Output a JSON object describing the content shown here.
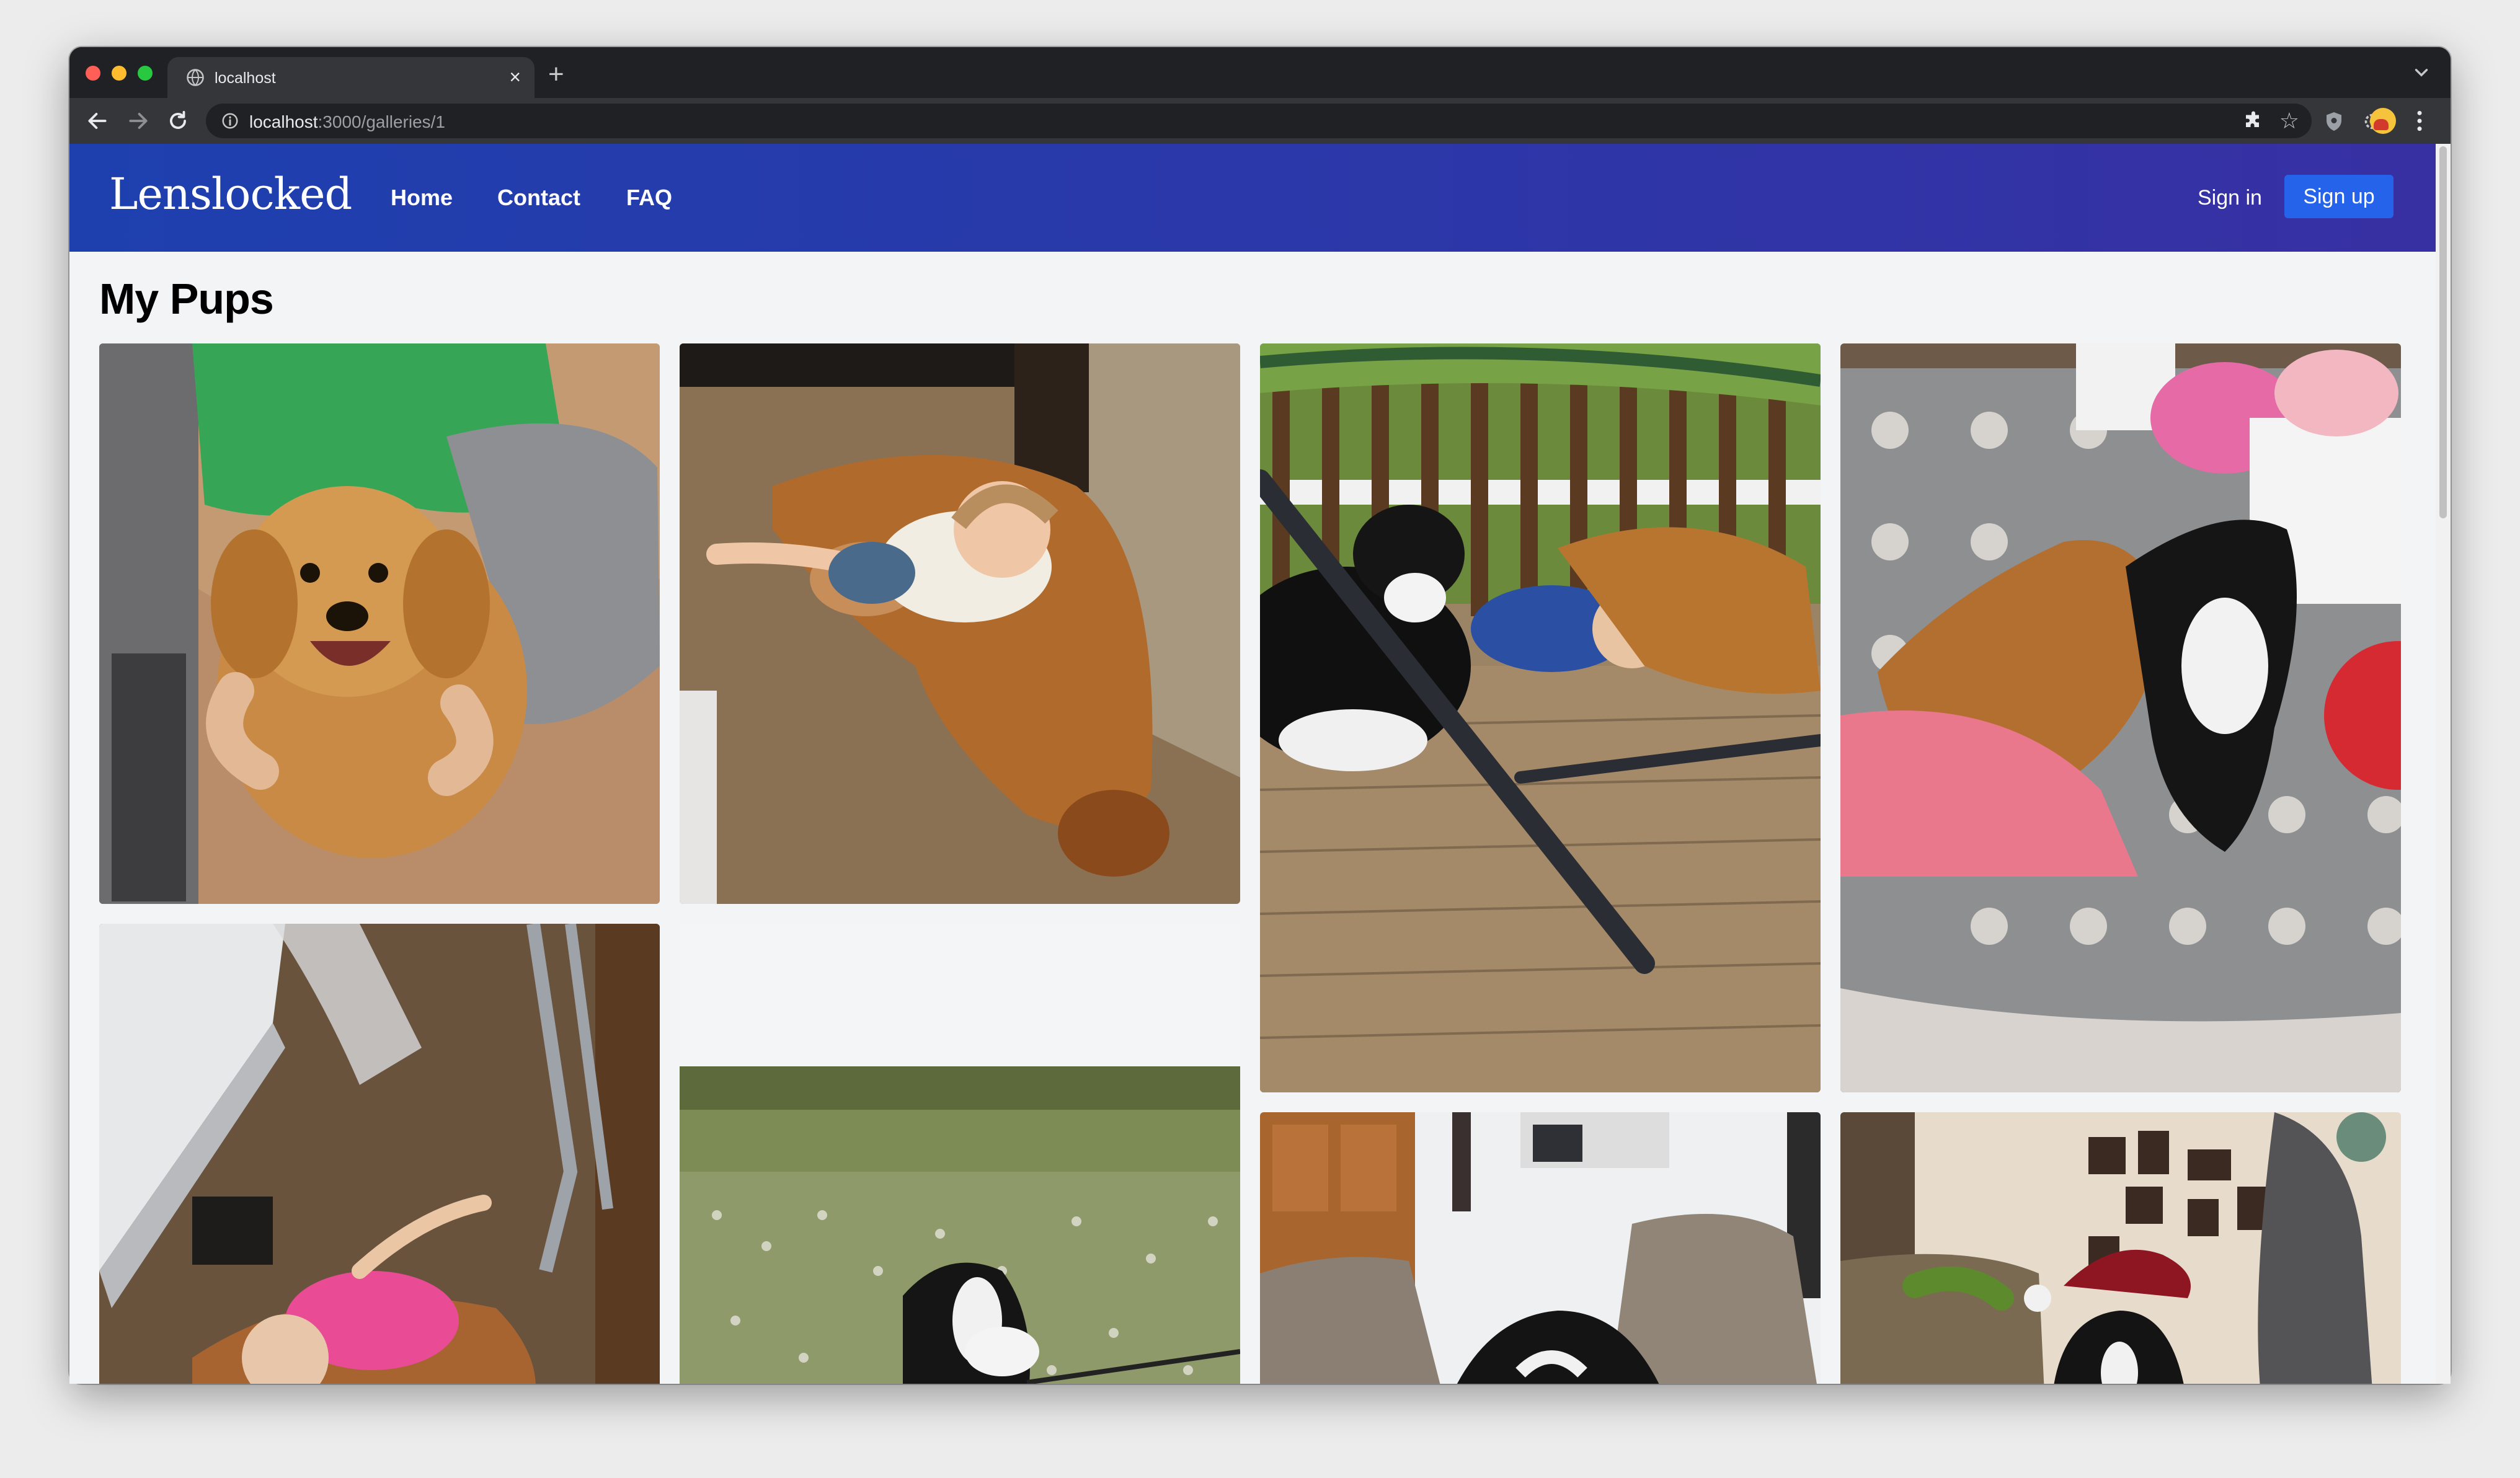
{
  "browser": {
    "tab_title": "localhost",
    "url_host": "localhost",
    "url_path": ":3000/galleries/1"
  },
  "navbar": {
    "brand": "Lenslocked",
    "links": [
      "Home",
      "Contact",
      "FAQ"
    ],
    "sign_in": "Sign in",
    "sign_up": "Sign up"
  },
  "gallery": {
    "title": "My Pups",
    "photos": [
      {
        "subject": "golden-retriever-puppy"
      },
      {
        "subject": "baby-with-golden-retriever"
      },
      {
        "subject": "dogs-and-baby-on-deck"
      },
      {
        "subject": "two-dogs-on-rug"
      },
      {
        "subject": "baby-and-dog-on-floor"
      },
      {
        "subject": "border-collie-in-field"
      },
      {
        "subject": "dog-on-couch"
      },
      {
        "subject": "dog-in-santa-hat"
      }
    ]
  }
}
